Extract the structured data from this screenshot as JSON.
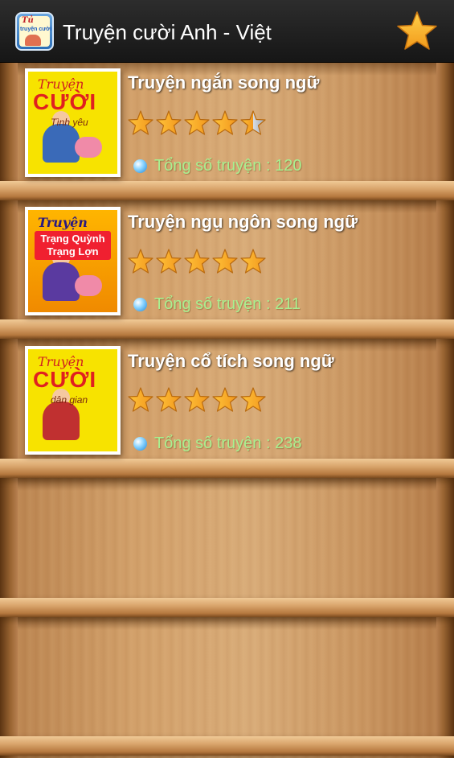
{
  "app": {
    "title": "Truyện cười Anh - Việt",
    "icon": "app-logo-icon",
    "icon_text_top": "Tủ",
    "icon_text_bottom": "truyện cười",
    "favorite_icon": "star-icon"
  },
  "books": [
    {
      "title": "Truyện ngắn song ngữ",
      "rating": 4.5,
      "rating_max": 5,
      "count_label": "Tổng số truyện : 120",
      "cover_line1": "Truyện",
      "cover_line2": "CƯỜI",
      "cover_line3": "Tình yêu"
    },
    {
      "title": "Truyện ngụ ngôn song ngữ",
      "rating": 5,
      "rating_max": 5,
      "count_label": "Tổng số truyện : 211",
      "cover_line1": "Truyện",
      "cover_line2": "Trạng Quỳnh Trạng Lợn",
      "cover_line3": ""
    },
    {
      "title": "Truyện cổ tích song ngữ",
      "rating": 5,
      "rating_max": 5,
      "count_label": "Tổng số truyện : 238",
      "cover_line1": "Truyện",
      "cover_line2": "CƯỜI",
      "cover_line3": "dân gian"
    }
  ],
  "colors": {
    "actionbar": "#1f1f1f",
    "count_text": "#a8f090",
    "star_fill": "#f5a623"
  }
}
